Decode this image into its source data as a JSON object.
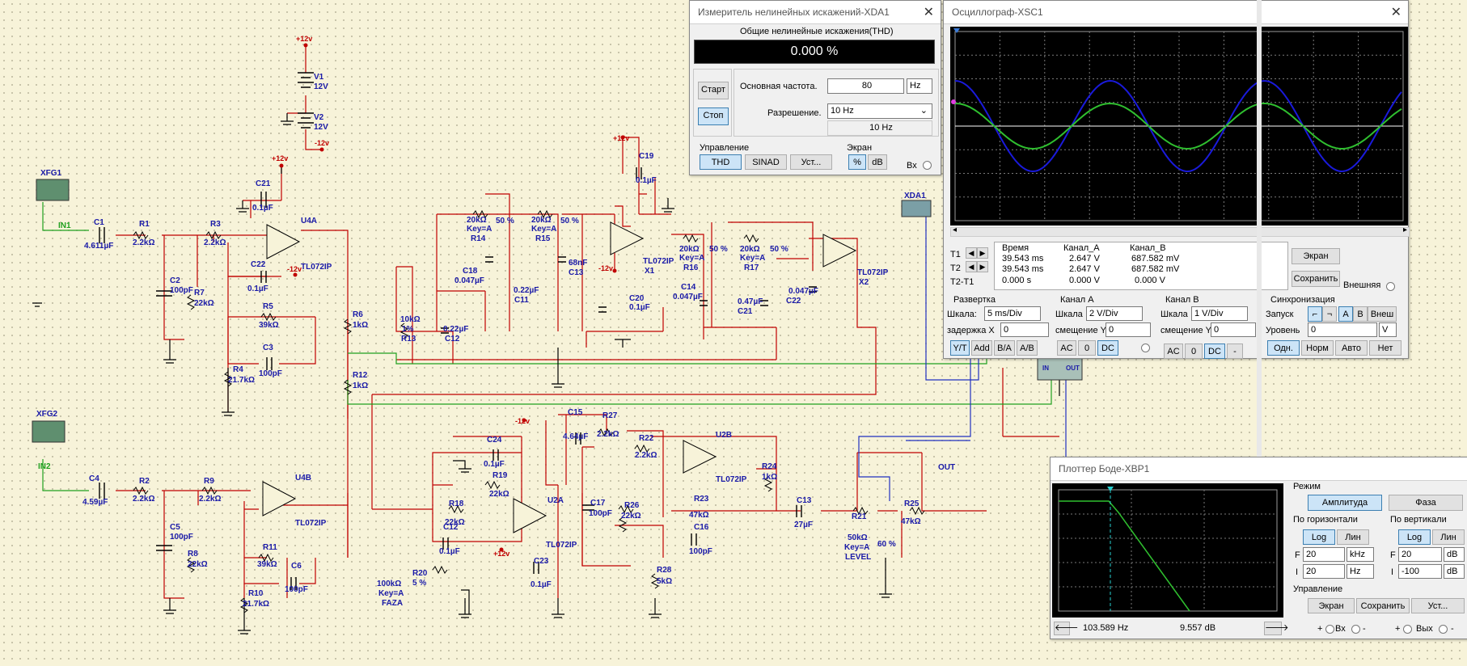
{
  "schematic": {
    "labels": {
      "xfg1": "XFG1",
      "xfg2": "XFG2",
      "in1": "IN1",
      "in2": "IN2",
      "c1": "C1",
      "c1v": "4.611µF",
      "r1": "R1",
      "r1v": "2.2kΩ",
      "r3": "R3",
      "r3v": "2.2kΩ",
      "c2": "C2",
      "c2v": "100pF",
      "r7": "R7",
      "r7v": "22kΩ",
      "c21a": "C21",
      "c21av": "0.1µF",
      "c22a": "C22",
      "c22av": "0.1µF",
      "u4a": "U4A",
      "u4apart": "TL072IP",
      "r5": "R5",
      "r5v": "39kΩ",
      "c3": "C3",
      "c3v": "100pF",
      "r4": "R4",
      "r4v": "21.7kΩ",
      "r6": "R6",
      "r6v": "1kΩ",
      "r12": "R12",
      "r12v": "1kΩ",
      "v1": "V1",
      "v1v": "12V",
      "v2": "V2",
      "v2v": "12V",
      "p12a": "+12v",
      "p12b": "+12v",
      "m12a": "-12v",
      "m12b": "-12v",
      "c4": "C4",
      "c4v": "4.59µF",
      "r2": "R2",
      "r2v": "2.2kΩ",
      "r9": "R9",
      "r9v": "2.2kΩ",
      "c5": "C5",
      "c5v": "100pF",
      "r8": "R8",
      "r8v": "22kΩ",
      "u4b": "U4B",
      "u4bpart": "TL072IP",
      "r11": "R11",
      "r11v": "39kΩ",
      "c6": "C6",
      "c6v": "100pF",
      "r10": "R10",
      "r10v": "21.7kΩ",
      "r14v": "20kΩ",
      "r14k": "Key=A",
      "r14": "R14",
      "r14p": "50 %",
      "r15v": "20kΩ",
      "r15k": "Key=A",
      "r15": "R15",
      "r15p": "50 %",
      "c18": "C18",
      "c18v": "0.047µF",
      "c11v": "0.22µF",
      "c11": "C11",
      "c13a": "68nF",
      "c13an": "C13",
      "r13v": "10kΩ",
      "r13p": "1%",
      "r13": "R13",
      "c12a": "0.22µF",
      "c12an": "C12",
      "p12c": "+12v",
      "c19": "C19",
      "c19v": "0.1µF",
      "m12c": "-12v",
      "c20": "C20",
      "c20v": "0.1µF",
      "x1part": "TL072IP",
      "x1": "X1",
      "r16v": "20kΩ",
      "r16k": "Key=A",
      "r16": "R16",
      "r16p": "50 %",
      "r17v": "20kΩ",
      "r17k": "Key=A",
      "r17": "R17",
      "r17p": "50 %",
      "c14": "C14",
      "c14v": "0.047µF",
      "c21bv": "0.47µF",
      "c21b": "C21",
      "c22bv": "0.047µF",
      "c22b": "C22",
      "x2part": "TL072IP",
      "x2": "X2",
      "xda1": "XDA1",
      "m12d": "-12v",
      "c15": "C15",
      "c15v": "4.64µF",
      "r27": "R27",
      "r27v": "2.2kΩ",
      "c24": "C24",
      "c24v": "0.1µF",
      "r19": "R19",
      "r19v": "22kΩ",
      "r18": "R18",
      "r18v": "22kΩ",
      "c12b": "C12",
      "c12bv": "0.1µF",
      "u2a": "U2A",
      "u2apart": "TL072IP",
      "p12d": "+12v",
      "c23": "C23",
      "c23v": "0.1µF",
      "r20v": "100kΩ",
      "r20k": "Key=A",
      "r20l": "FAZA",
      "r20": "R20",
      "r20p": "5 %",
      "c17": "C17",
      "c17v": "100pF",
      "r26": "R26",
      "r26v": "22kΩ",
      "r22": "R22",
      "r22v": "2.2kΩ",
      "u2b": "U2B",
      "u2bpart": "TL072IP",
      "r24": "R24",
      "r24v": "1kΩ",
      "r23": "R23",
      "r23v": "47kΩ",
      "c16": "C16",
      "c16v": "100pF",
      "r28": "R28",
      "r28v": "5kΩ",
      "c13b": "C13",
      "c13bv": "27µF",
      "r21v": "50kΩ",
      "r21k": "Key=A",
      "r21l": "LEVEL",
      "r21": "R21",
      "r21p": "60 %",
      "r25": "R25",
      "r25v": "47kΩ",
      "out": "OUT",
      "bin": "IN",
      "bout": "OUT"
    }
  },
  "thd": {
    "title": "Измеритель нелинейных искажений-XDA1",
    "heading": "Общие нелинейные искажения(THD)",
    "value": "0.000 %",
    "start": "Старт",
    "stop": "Стоп",
    "freq_label": "Основная частота.",
    "freq_value": "80",
    "freq_unit": "Hz",
    "res_label": "Разрешение.",
    "res_value": "10 Hz",
    "res_display": "10 Hz",
    "control_label": "Управление",
    "mode_thd": "THD",
    "mode_sinad": "SINAD",
    "settings": "Уст...",
    "screen_label": "Экран",
    "unit_pct": "%",
    "unit_db": "dB",
    "in_label": "Вх"
  },
  "scope": {
    "title": "Осциллограф-XSC1",
    "col_time": "Время",
    "col_a": "Канал_A",
    "col_b": "Канал_B",
    "t1": "T1",
    "t2": "T2",
    "t2t1": "T2-T1",
    "t1_time": "39.543 ms",
    "t1_a": "2.647 V",
    "t1_b": "687.582 mV",
    "t2_time": "39.543 ms",
    "t2_a": "2.647 V",
    "t2_b": "687.582 mV",
    "d_time": "0.000 s",
    "d_a": "0.000 V",
    "d_b": "0.000 V",
    "btn_screen": "Экран",
    "btn_save": "Сохранить",
    "external": "Внешняя",
    "timebase": {
      "title": "Развертка",
      "scale_label": "Шкала:",
      "scale": "5 ms/Div",
      "delay_label": "задержка X",
      "delay": "0",
      "yt": "Y/T",
      "add": "Add",
      "ba": "B/A",
      "ab": "A/B"
    },
    "chA": {
      "title": "Канал A",
      "scale_label": "Шкала",
      "scale": "2 V/Div",
      "offset_label": "смещение Y",
      "offset": "0",
      "ac": "AC",
      "zero": "0",
      "dc": "DC"
    },
    "chB": {
      "title": "Канал B",
      "scale_label": "Шкала",
      "scale": "1 V/Div",
      "offset_label": "смещение Y",
      "offset": "0",
      "ac": "AC",
      "zero": "0",
      "dc": "DC",
      "minus": "-"
    },
    "trigger": {
      "title": "Синхронизация",
      "launch_label": "Запуск",
      "a": "A",
      "b": "B",
      "ext": "Внеш",
      "level_label": "Уровень",
      "level": "0",
      "level_unit": "V",
      "single": "Одн.",
      "normal": "Норм",
      "auto": "Авто",
      "none": "Нет"
    },
    "colors": {
      "channel_a": "#1a1adb",
      "channel_b": "#2fbf2f"
    }
  },
  "bode": {
    "title": "Плоттер Боде-XBP1",
    "mode_label": "Режим",
    "amplitude": "Амплитуда",
    "phase": "Фаза",
    "horiz_label": "По горизонтали",
    "vert_label": "По вертикали",
    "log": "Log",
    "lin": "Лин",
    "h_f_label": "F",
    "h_f": "20",
    "h_f_unit": "kHz",
    "h_i_label": "I",
    "h_i": "20",
    "h_i_unit": "Hz",
    "v_f_label": "F",
    "v_f": "20",
    "v_f_unit": "dB",
    "v_i_label": "I",
    "v_i": "-100",
    "v_i_unit": "dB",
    "control_label": "Управление",
    "screen": "Экран",
    "save": "Сохранить",
    "settings": "Уст...",
    "readout_freq": "103.589  Hz",
    "readout_db": "9.557 dB",
    "in_label": "Вх",
    "out_label": "Вых",
    "plus": "+",
    "minus": "-"
  }
}
